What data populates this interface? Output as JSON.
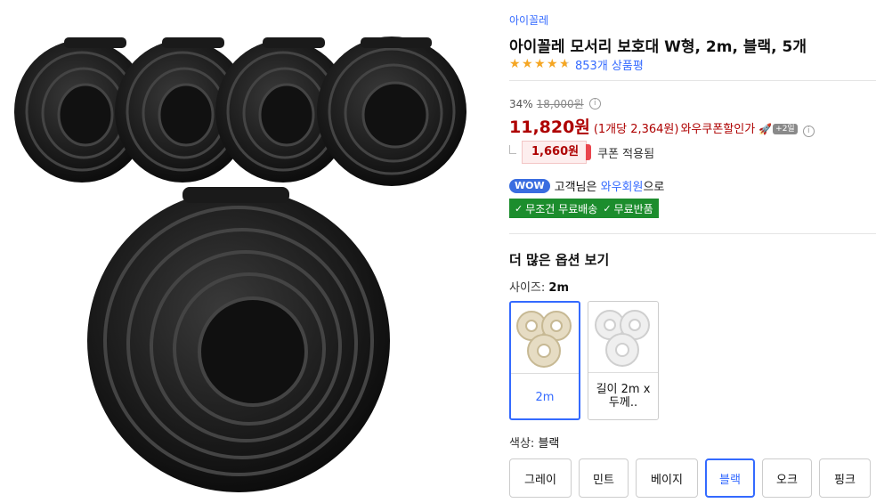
{
  "product": {
    "brand": "아이꼴레",
    "title": "아이꼴레 모서리 보호대 W형, 2m, 블랙, 5개",
    "rating": 4.5,
    "review_count": "853개 상품평"
  },
  "price": {
    "discount_rate": "34%",
    "original_price": "18,000원",
    "sale_price": "11,820원",
    "unit_price": "(1개당 2,364원)",
    "coupon_discount_label": "와우쿠폰할인가",
    "rocket_badge": "+2일",
    "coupon_amount": "1,660원",
    "coupon_applied": "쿠폰 적용됨",
    "info_icon": "ⓘ"
  },
  "membership": {
    "wow_badge": "WOW",
    "text_prefix": "고객님은 ",
    "member_name": "와우회원",
    "text_suffix": "으로",
    "free_shipping": "무조건 무료배송",
    "free_return": "무료반품"
  },
  "options": {
    "heading": "더 많은 옵션 보기",
    "size_label": "사이즈: ",
    "size_selected": "2m",
    "sizes": [
      {
        "caption": "2m",
        "selected": true
      },
      {
        "caption": "길이 2m x 두께..",
        "selected": false
      }
    ],
    "color_label": "색상: ",
    "color_selected": "블랙",
    "colors": [
      {
        "label": "그레이",
        "selected": false
      },
      {
        "label": "민트",
        "selected": false
      },
      {
        "label": "베이지",
        "selected": false
      },
      {
        "label": "블랙",
        "selected": true
      },
      {
        "label": "오크",
        "selected": false
      },
      {
        "label": "핑크",
        "selected": false
      }
    ]
  },
  "colors": {
    "accent": "#346aff",
    "price_red": "#ae0000",
    "free_green": "#1c8d2d",
    "star": "#f5a623"
  }
}
